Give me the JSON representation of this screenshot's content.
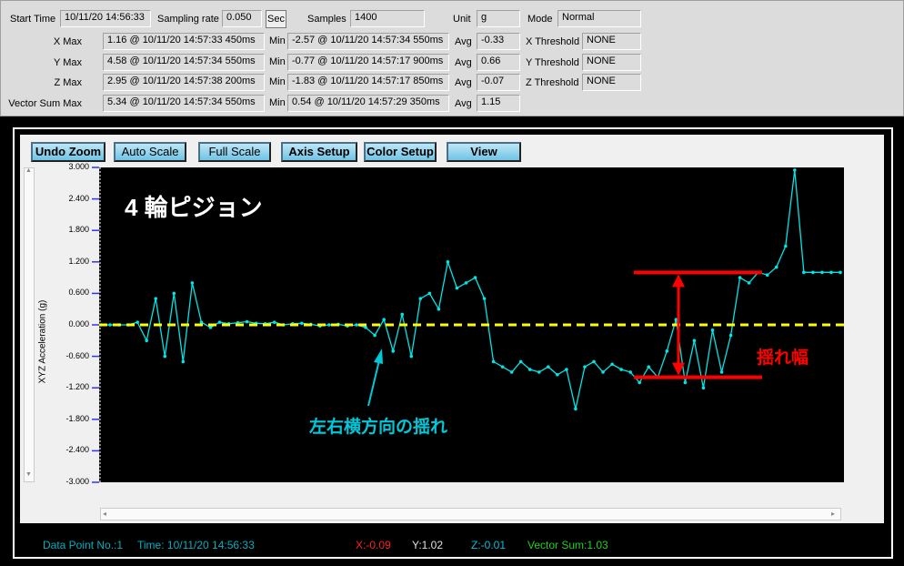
{
  "header": {
    "start_time_label": "Start Time",
    "start_time": "10/11/20 14:56:33",
    "sampling_rate_label": "Sampling rate",
    "sampling_rate": "0.050",
    "sec_button": "Sec",
    "samples_label": "Samples",
    "samples": "1400",
    "unit_label": "Unit",
    "unit": "g",
    "mode_label": "Mode",
    "mode": "Normal",
    "rows": [
      {
        "label": "X  Max",
        "max": "1.16 @ 10/11/20 14:57:33 450ms",
        "min_label": "Min",
        "min": "-2.57 @ 10/11/20 14:57:34 550ms",
        "avg_label": "Avg",
        "avg": "-0.33",
        "th_label": "X Threshold",
        "th": "NONE"
      },
      {
        "label": "Y Max",
        "max": "4.58 @ 10/11/20 14:57:34 550ms",
        "min_label": "Min",
        "min": "-0.77 @ 10/11/20 14:57:17 900ms",
        "avg_label": "Avg",
        "avg": "0.66",
        "th_label": "Y Threshold",
        "th": "NONE"
      },
      {
        "label": "Z  Max",
        "max": "2.95 @ 10/11/20 14:57:38 200ms",
        "min_label": "Min",
        "min": "-1.83 @ 10/11/20 14:57:17 850ms",
        "avg_label": "Avg",
        "avg": "-0.07",
        "th_label": "Z Threshold",
        "th": "NONE"
      },
      {
        "label": "Vector Sum Max",
        "max": "5.34 @ 10/11/20 14:57:34 550ms",
        "min_label": "Min",
        "min": "0.54 @ 10/11/20 14:57:29 350ms",
        "avg_label": "Avg",
        "avg": "1.15"
      }
    ]
  },
  "toolbar": [
    "Undo Zoom",
    "Auto Scale",
    "Full Scale",
    "Axis Setup",
    "Color Setup",
    "View"
  ],
  "chart_data": {
    "type": "line",
    "ylabel": "XYZ  Acceleration (g)",
    "ylim": [
      -3,
      3
    ],
    "yticks": [
      "3.000",
      "2.400",
      "1.800",
      "1.200",
      "0.600",
      "0.000",
      "-0.600",
      "-1.200",
      "-1.800",
      "-2.400",
      "-3.000"
    ],
    "series_color": "#00e5e5",
    "zero_line_color": "#ffff00",
    "values": [
      0,
      0,
      0,
      0,
      0.05,
      -0.3,
      0.5,
      -0.6,
      0.6,
      -0.7,
      0.8,
      0.05,
      -0.05,
      0.05,
      0.02,
      0.04,
      0.06,
      0.03,
      0.02,
      0.05,
      0,
      0.02,
      0.03,
      0.01,
      -0.02,
      0,
      0.01,
      -0.02,
      0,
      -0.05,
      -0.2,
      0.1,
      -0.5,
      0.2,
      -0.6,
      0.5,
      0.6,
      0.3,
      1.2,
      0.7,
      0.8,
      0.9,
      0.5,
      -0.7,
      -0.8,
      -0.9,
      -0.7,
      -0.85,
      -0.9,
      -0.8,
      -0.95,
      -0.85,
      -1.6,
      -0.8,
      -0.7,
      -0.9,
      -0.75,
      -0.85,
      -0.9,
      -1.1,
      -0.8,
      -1.0,
      -0.5,
      0.1,
      -1.1,
      -0.3,
      -1.2,
      -0.1,
      -0.9,
      -0.2,
      0.9,
      0.8,
      1.0,
      0.95,
      1.1,
      1.5,
      2.95,
      1.0,
      1.0,
      1.0,
      1.0,
      1.0
    ],
    "annotations": {
      "title": "4 輪ピジョン",
      "sway_label": "左右横方向の揺れ",
      "range_label": "揺れ幅",
      "range_levels": [
        1.0,
        -1.0
      ],
      "range_color": "#ff0000",
      "sway_color": "#00c8d8"
    }
  },
  "status": {
    "point": "Data Point No.:1",
    "time": "Time: 10/11/20 14:56:33",
    "x": "X:-0.09",
    "y": "Y:1.02",
    "z": "Z:-0.01",
    "vsum": "Vector Sum:1.03"
  }
}
